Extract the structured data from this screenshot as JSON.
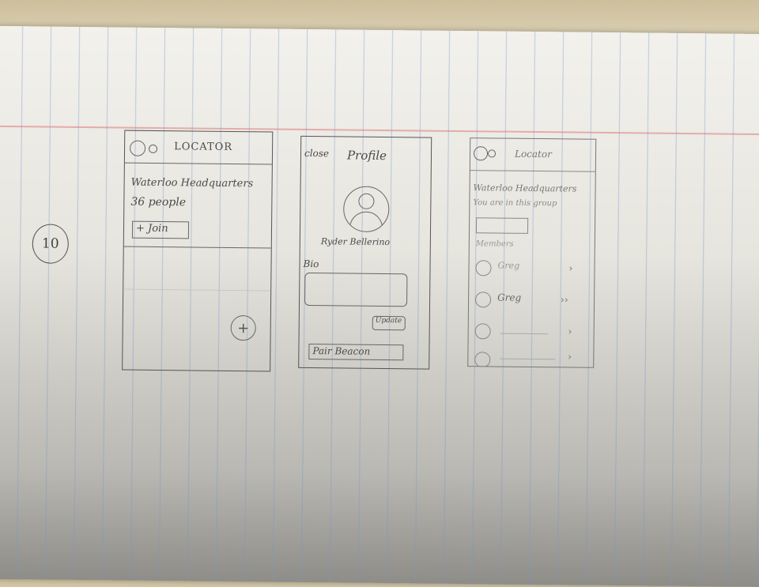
{
  "page_number": "10",
  "screen1": {
    "title": "LOCATOR",
    "card_location": "Waterloo Headquarters",
    "card_people": "36 people",
    "join_button": "+ Join",
    "fab_label": "+"
  },
  "screen2": {
    "close_label": "close",
    "title": "Profile",
    "user_name": "Ryder Bellerino",
    "bio_label": "Bio",
    "update_button": "Update",
    "pair_button": "Pair Beacon"
  },
  "screen3": {
    "title": "Locator",
    "location": "Waterloo Headquarters",
    "subtitle": "You are in this group",
    "members_label": "Members",
    "members": [
      "Greg",
      "Greg",
      "",
      ""
    ]
  }
}
